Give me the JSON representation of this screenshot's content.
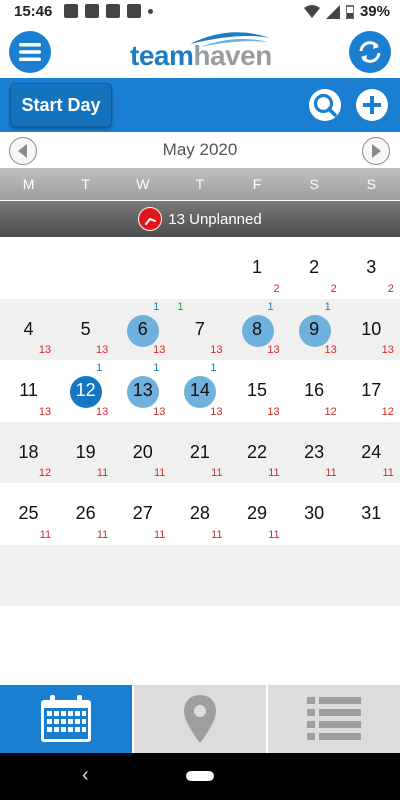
{
  "status_bar": {
    "time": "15:46",
    "battery": "39%"
  },
  "header": {
    "logo_team": "team",
    "logo_haven": "haven"
  },
  "toolbar": {
    "start_day_label": "Start Day"
  },
  "calendar": {
    "month_title": "May 2020",
    "weekdays": [
      "M",
      "T",
      "W",
      "T",
      "F",
      "S",
      "S"
    ],
    "unplanned_text": "13 Unplanned",
    "weeks": [
      [
        {
          "day": "",
          "count": ""
        },
        {
          "day": "",
          "count": ""
        },
        {
          "day": "",
          "count": ""
        },
        {
          "day": "",
          "count": ""
        },
        {
          "day": "1",
          "count": "2"
        },
        {
          "day": "2",
          "count": "2"
        },
        {
          "day": "3",
          "count": "2"
        }
      ],
      [
        {
          "day": "4",
          "count": "13"
        },
        {
          "day": "5",
          "count": "13"
        },
        {
          "day": "6",
          "count": "13",
          "top": "1",
          "highlight": "light"
        },
        {
          "day": "7",
          "count": "13",
          "green": "1"
        },
        {
          "day": "8",
          "count": "13",
          "top": "1",
          "highlight": "light"
        },
        {
          "day": "9",
          "count": "13",
          "top": "1",
          "highlight": "light"
        },
        {
          "day": "10",
          "count": "13"
        }
      ],
      [
        {
          "day": "11",
          "count": "13"
        },
        {
          "day": "12",
          "count": "13",
          "top": "1",
          "highlight": "dark"
        },
        {
          "day": "13",
          "count": "13",
          "top": "1",
          "highlight": "light"
        },
        {
          "day": "14",
          "count": "13",
          "top": "1",
          "highlight": "light"
        },
        {
          "day": "15",
          "count": "13"
        },
        {
          "day": "16",
          "count": "12"
        },
        {
          "day": "17",
          "count": "12"
        }
      ],
      [
        {
          "day": "18",
          "count": "12"
        },
        {
          "day": "19",
          "count": "11"
        },
        {
          "day": "20",
          "count": "11"
        },
        {
          "day": "21",
          "count": "11"
        },
        {
          "day": "22",
          "count": "11"
        },
        {
          "day": "23",
          "count": "11"
        },
        {
          "day": "24",
          "count": "11"
        }
      ],
      [
        {
          "day": "25",
          "count": "11"
        },
        {
          "day": "26",
          "count": "11"
        },
        {
          "day": "27",
          "count": "11"
        },
        {
          "day": "28",
          "count": "11"
        },
        {
          "day": "29",
          "count": "11"
        },
        {
          "day": "30",
          "count": ""
        },
        {
          "day": "31",
          "count": ""
        }
      ]
    ]
  },
  "tabs": [
    {
      "name": "calendar",
      "icon": "calendar-icon",
      "active": true
    },
    {
      "name": "map",
      "icon": "map-pin-icon",
      "active": false
    },
    {
      "name": "list",
      "icon": "list-icon",
      "active": false
    }
  ],
  "colors": {
    "brand_blue": "#1a7fd0",
    "highlight_light": "#6fb0dc",
    "highlight_dark": "#1577c2",
    "count_red": "#d32a2a",
    "unplanned_red": "#e0161c"
  }
}
